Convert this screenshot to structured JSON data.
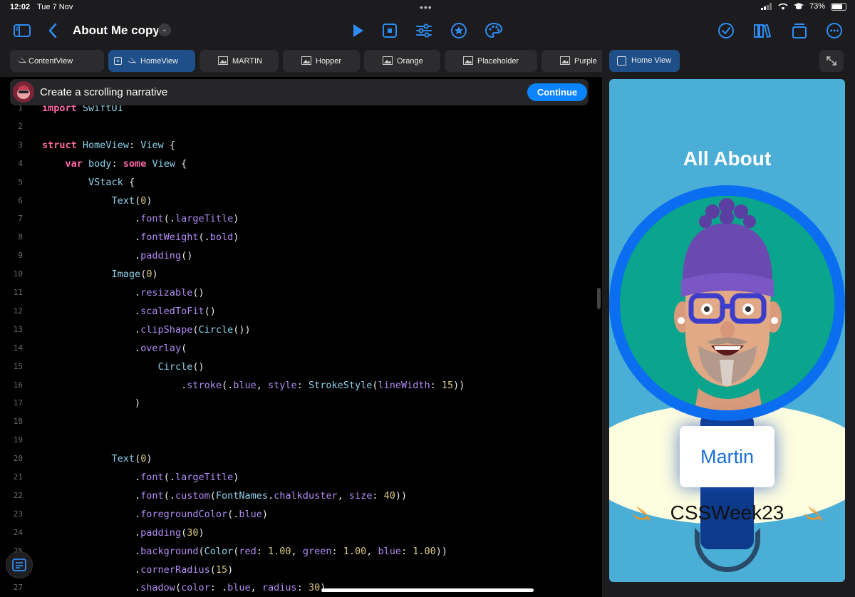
{
  "status_bar": {
    "time": "12:02",
    "date": "Tue 7 Nov",
    "battery": "73%"
  },
  "toolbar": {
    "title": "About Me copy 2"
  },
  "tabs": [
    {
      "label": "ContentView",
      "kind": "swift"
    },
    {
      "label": "HomeView",
      "kind": "swift",
      "active": true
    },
    {
      "label": "MARTIN",
      "kind": "image"
    },
    {
      "label": "Hopper",
      "kind": "image"
    },
    {
      "label": "Orange",
      "kind": "image"
    },
    {
      "label": "Placeholder",
      "kind": "image"
    },
    {
      "label": "Purple",
      "kind": "image"
    }
  ],
  "banner": {
    "text": "Create a scrolling narrative",
    "button": "Continue"
  },
  "code_lines": [
    {
      "n": "1",
      "text": "import SwiftUI"
    },
    {
      "n": "2",
      "text": ""
    },
    {
      "n": "3",
      "text": "struct HomeView: View {"
    },
    {
      "n": "4",
      "text": "    var body: some View {"
    },
    {
      "n": "5",
      "text": "        VStack {"
    },
    {
      "n": "6",
      "text": "            Text(\"All About\")"
    },
    {
      "n": "7",
      "text": "                .font(.largeTitle)"
    },
    {
      "n": "8",
      "text": "                .fontWeight(.bold)"
    },
    {
      "n": "9",
      "text": "                .padding()"
    },
    {
      "n": "10",
      "text": "            Image(\"MARTIN\")"
    },
    {
      "n": "11",
      "text": "                .resizable()"
    },
    {
      "n": "12",
      "text": "                .scaledToFit()"
    },
    {
      "n": "13",
      "text": "                .clipShape(Circle())"
    },
    {
      "n": "14",
      "text": "                .overlay("
    },
    {
      "n": "15",
      "text": "                    Circle()"
    },
    {
      "n": "16",
      "text": "                        .stroke(.blue, style: StrokeStyle(lineWidth: 15))"
    },
    {
      "n": "17",
      "text": "                )"
    },
    {
      "n": "18",
      "text": ""
    },
    {
      "n": "19",
      "text": ""
    },
    {
      "n": "20",
      "text": "            Text(\"Martin\")"
    },
    {
      "n": "21",
      "text": "                .font(.largeTitle)"
    },
    {
      "n": "22",
      "text": "                .font(.custom(FontNames.chalkduster, size: 40))"
    },
    {
      "n": "23",
      "text": "                .foregroundColor(.blue)"
    },
    {
      "n": "24",
      "text": "                .padding(30)"
    },
    {
      "n": "25",
      "text": "                .background(Color(red: 1.00, green: 1.00, blue: 1.00))"
    },
    {
      "n": "26",
      "text": "                .cornerRadius(15)"
    },
    {
      "n": "27",
      "text": "                .shadow(color: .blue, radius: 30)"
    }
  ],
  "preview": {
    "tab_label": "Home View",
    "headline": "All About",
    "name": "Martin",
    "hashtag": "CSSWeek23"
  },
  "colors": {
    "accent": "#0a84ff",
    "preview_bg": "#4aaed6",
    "ring": "#0b6ef0",
    "avatar_bg": "#0aa58c",
    "swift_orange": "#f7921e"
  }
}
